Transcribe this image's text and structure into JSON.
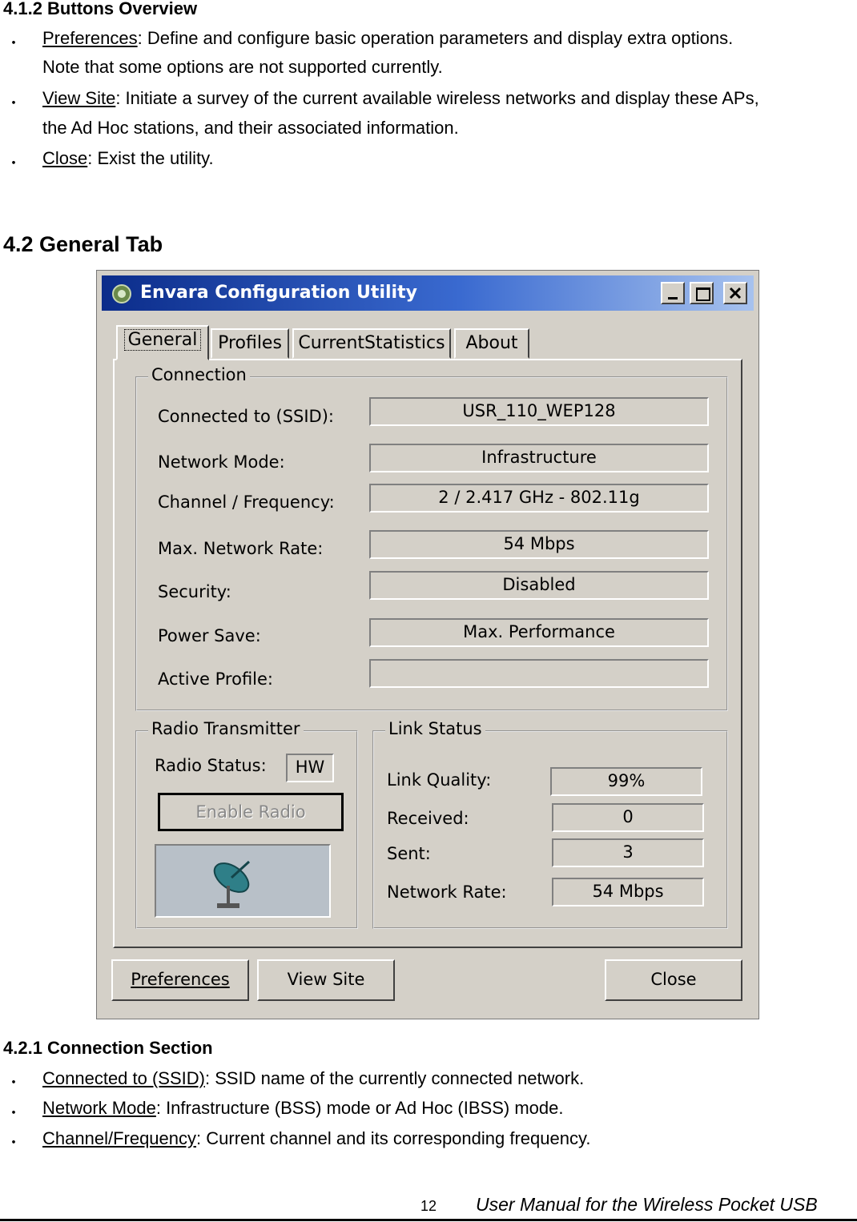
{
  "sec412": {
    "heading": "4.1.2 Buttons Overview",
    "items": [
      {
        "term": "Preferences",
        "line1": ": Define and configure basic operation parameters and display extra options.",
        "line2": "Note that some options are not supported currently."
      },
      {
        "term": "View Site",
        "line1": ": Initiate a survey of the current available wireless networks and display these APs,",
        "line2": "the Ad Hoc stations, and their associated information."
      },
      {
        "term": "Close",
        "line1": ": Exist the utility.",
        "line2": ""
      }
    ]
  },
  "sec42": {
    "heading": "4.2 General Tab"
  },
  "window": {
    "title": "Envara Configuration Utility",
    "tabs": [
      "General",
      "Profiles",
      "CurrentStatistics",
      "About"
    ],
    "connection": {
      "title": "Connection",
      "rows": [
        {
          "label": "Connected to (SSID):",
          "value": "USR_110_WEP128"
        },
        {
          "label": "Network Mode:",
          "value": "Infrastructure"
        },
        {
          "label": "Channel / Frequency:",
          "value": "2 / 2.417 GHz - 802.11g"
        },
        {
          "label": "Max. Network Rate:",
          "value": "54 Mbps"
        },
        {
          "label": "Security:",
          "value": "Disabled"
        },
        {
          "label": "Power Save:",
          "value": "Max. Performance"
        },
        {
          "label": "Active Profile:",
          "value": ""
        }
      ]
    },
    "radio": {
      "title": "Radio Transmitter",
      "status_label": "Radio Status:",
      "status_value": "HW",
      "enable_button": "Enable Radio"
    },
    "link": {
      "title": "Link Status",
      "rows": [
        {
          "label": "Link Quality:",
          "value": "99%"
        },
        {
          "label": "Received:",
          "value": "0"
        },
        {
          "label": "Sent:",
          "value": "3"
        },
        {
          "label": "Network Rate:",
          "value": "54 Mbps"
        }
      ]
    },
    "buttons": {
      "preferences": "Preferences",
      "view_site": "View Site",
      "close": "Close"
    }
  },
  "sec421": {
    "heading": "4.2.1 Connection Section",
    "items": [
      {
        "term": "Connected to (SSID)",
        "rest": ": SSID name of the currently connected network."
      },
      {
        "term": "Network Mode",
        "rest": ": Infrastructure (BSS) mode or Ad Hoc (IBSS) mode."
      },
      {
        "term": "Channel/Frequency",
        "rest": ": Current channel and its corresponding frequency."
      }
    ]
  },
  "footer": {
    "page_number": "12",
    "title": "User Manual for the Wireless Pocket USB"
  },
  "bullet_char": "・"
}
